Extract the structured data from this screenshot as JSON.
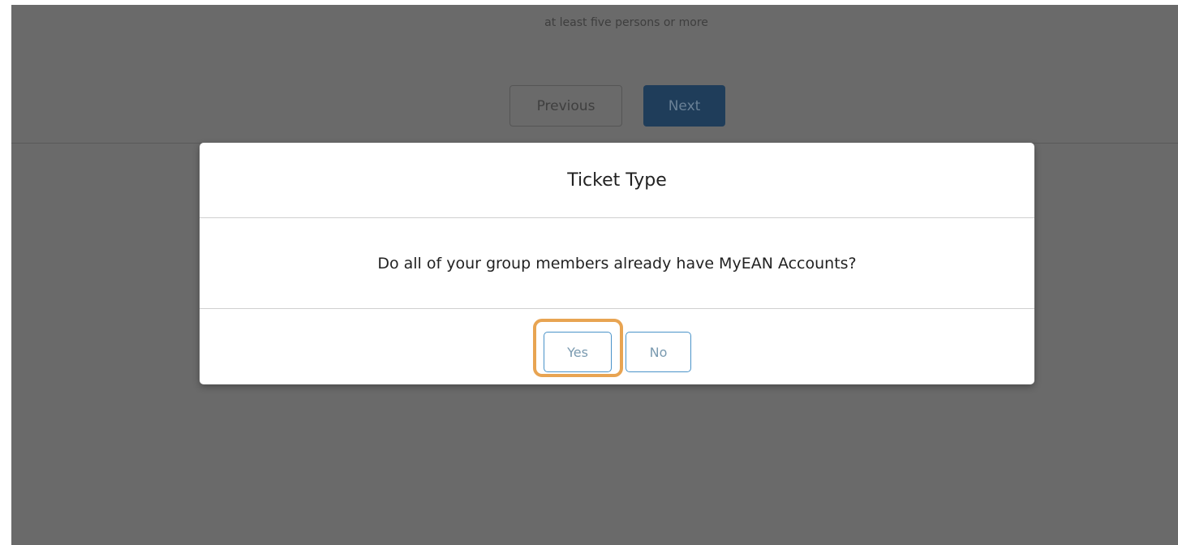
{
  "underlying_page": {
    "hint_text": "at least five persons or more",
    "previous_label": "Previous",
    "next_label": "Next"
  },
  "modal": {
    "title": "Ticket Type",
    "question": "Do all of your group members already have MyEAN Accounts?",
    "yes_label": "Yes",
    "no_label": "No"
  },
  "colors": {
    "overlay": "#6a6a6a",
    "highlight": "#e8a452",
    "button_border": "#4a93c9",
    "next_button": "#1f3d5a"
  }
}
